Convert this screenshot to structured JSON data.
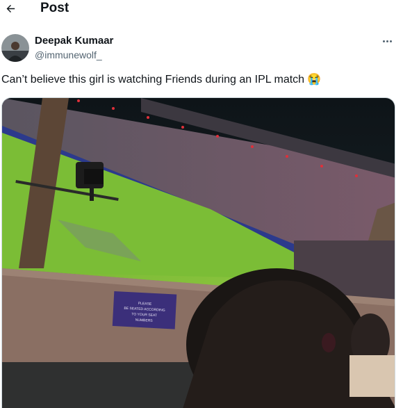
{
  "header": {
    "title": "Post",
    "back_icon": "arrow-left-icon"
  },
  "author": {
    "name": "Deepak Kumaar",
    "handle": "@immunewolf_"
  },
  "tweet": {
    "text": "Can’t believe this girl is watching Friends during an IPL match",
    "emoji": "😭"
  },
  "media": {
    "sign_lines": [
      "PLEASE",
      "BE SEATED ACCORDING",
      "TO YOUR SEAT",
      "NUMBERS"
    ]
  },
  "colors": {
    "text": "#0f1419",
    "secondary": "#536471",
    "border": "#cfd9de"
  }
}
